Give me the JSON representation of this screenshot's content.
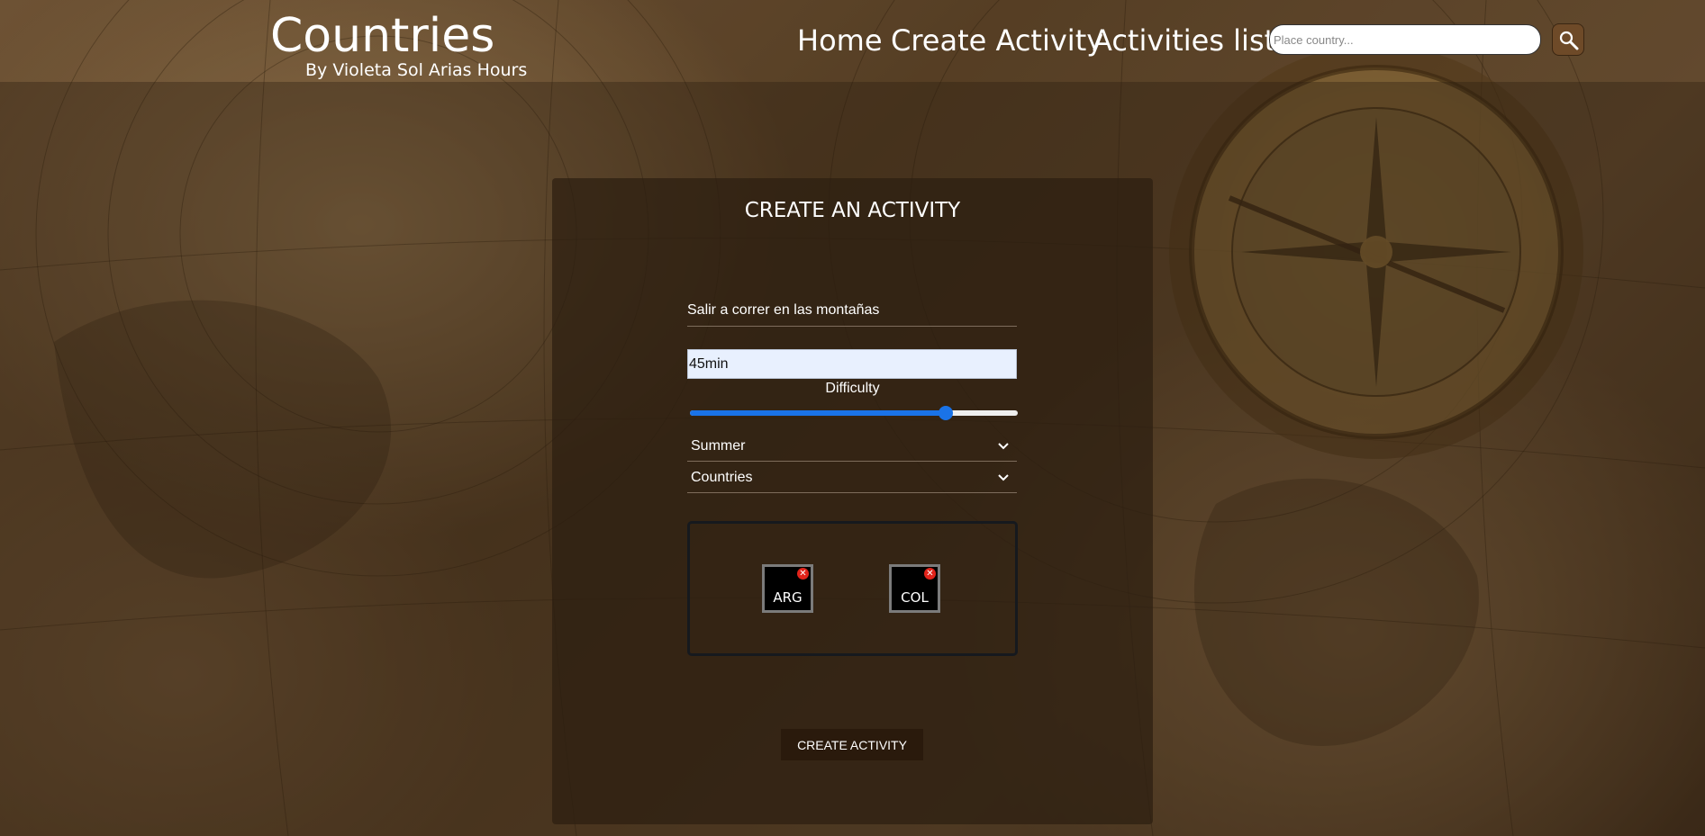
{
  "header": {
    "title": "Countries",
    "subtitle": "By Violeta Sol Arias Hours",
    "nav": {
      "home": "Home",
      "create_activity": "Create Activity",
      "activities_list": "Activities list"
    },
    "search": {
      "placeholder": "Place country...",
      "button_icon": "search-icon"
    }
  },
  "form": {
    "title": "CREATE AN ACTIVITY",
    "name_value": "Salir a correr en las montañas",
    "duration_value": "45min",
    "difficulty_label": "Difficulty",
    "difficulty_fraction": 0.78,
    "season_selected": "Summer",
    "countries_selected_label": "Countries",
    "selected_countries": [
      {
        "code": "ARG",
        "remove_icon": "close-icon"
      },
      {
        "code": "COL",
        "remove_icon": "close-icon"
      }
    ],
    "submit_label": "CREATE ACTIVITY"
  },
  "colors": {
    "slider_accent": "#1a73e8",
    "remove_badge": "#e2231a",
    "card_bg": "#2d1e11",
    "search_button_bg": "#6e4a28"
  }
}
